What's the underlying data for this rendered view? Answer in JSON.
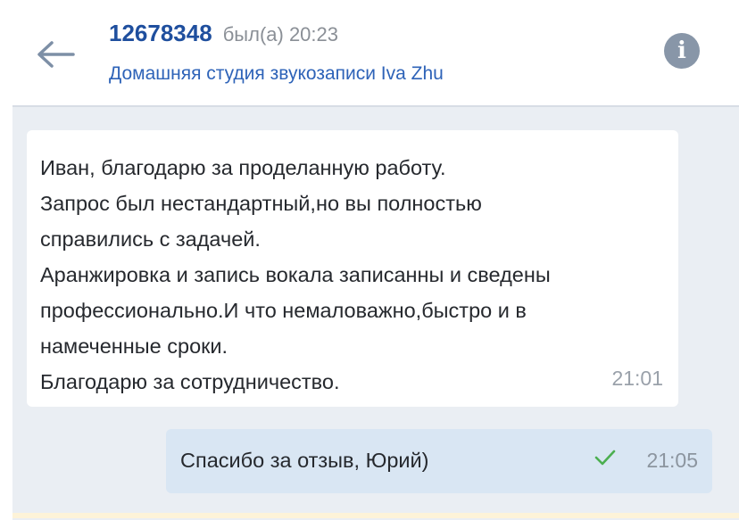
{
  "header": {
    "user_id": "12678348",
    "last_seen": "был(а) 20:23",
    "studio": "Домашняя студия звукозаписи Iva Zhu",
    "info_glyph": "i"
  },
  "icons": {
    "back": "arrow-left-icon",
    "info": "info-icon",
    "read": "checkmark-icon"
  },
  "messages": {
    "incoming": {
      "lines": [
        "Иван, благодарю за проделанную работу.",
        "Запрос был нестандартный,но вы полностью",
        "справились с задачей.",
        "Аранжировка и запись вокала записанны и сведены",
        "профессионально.И что немаловажно,быстро и в",
        "намеченные сроки.",
        "Благодарю за сотрудничество."
      ],
      "time": "21:01"
    },
    "outgoing": {
      "text": "Спасибо за отзыв, Юрий)",
      "time": "21:05"
    }
  },
  "colors": {
    "accent_dark": "#1f4f9e",
    "accent_link": "#2e63b8",
    "chat_bg": "#eaeef3",
    "outgoing_bubble": "#d9e6f3",
    "read_check": "#4caf50"
  }
}
